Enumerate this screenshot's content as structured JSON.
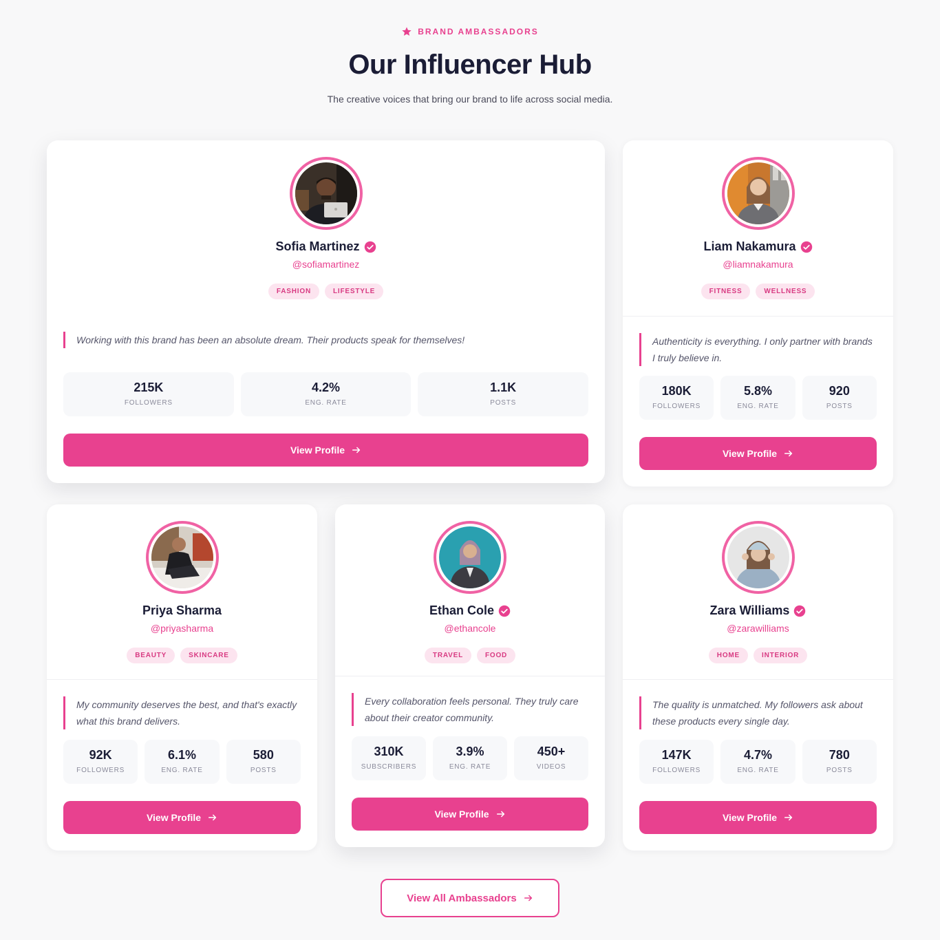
{
  "header": {
    "eyebrow": "BRAND AMBASSADORS",
    "title": "Our Influencer Hub",
    "subtitle": "The creative voices that bring our brand to life across social media."
  },
  "colors": {
    "accent": "#e8418f",
    "tag_bg": "#fce4ef",
    "heading": "#1b1d36"
  },
  "cards": [
    {
      "name": "Sofia Martinez",
      "verified": true,
      "handle": "@sofiamartinez",
      "tags": [
        "FASHION",
        "LIFESTYLE"
      ],
      "quote": "Working with this brand has been an absolute dream. Their products speak for themselves!",
      "stats": [
        {
          "value": "215K",
          "label": "FOLLOWERS"
        },
        {
          "value": "4.2%",
          "label": "ENG. RATE"
        },
        {
          "value": "1.1K",
          "label": "POSTS"
        }
      ],
      "cta": "View Profile",
      "avatar": "avatar-man-laptop"
    },
    {
      "name": "Liam Nakamura",
      "verified": true,
      "handle": "@liamnakamura",
      "tags": [
        "FITNESS",
        "WELLNESS"
      ],
      "quote": "Authenticity is everything. I only partner with brands I truly believe in.",
      "stats": [
        {
          "value": "180K",
          "label": "FOLLOWERS"
        },
        {
          "value": "5.8%",
          "label": "ENG. RATE"
        },
        {
          "value": "920",
          "label": "POSTS"
        }
      ],
      "cta": "View Profile",
      "avatar": "avatar-woman-blazer"
    },
    {
      "name": "Priya Sharma",
      "verified": false,
      "handle": "@priyasharma",
      "tags": [
        "BEAUTY",
        "SKINCARE"
      ],
      "quote": "My community deserves the best, and that's exactly what this brand delivers.",
      "stats": [
        {
          "value": "92K",
          "label": "FOLLOWERS"
        },
        {
          "value": "6.1%",
          "label": "ENG. RATE"
        },
        {
          "value": "580",
          "label": "POSTS"
        }
      ],
      "cta": "View Profile",
      "avatar": "avatar-man-seated"
    },
    {
      "name": "Ethan Cole",
      "verified": true,
      "handle": "@ethancole",
      "tags": [
        "TRAVEL",
        "FOOD"
      ],
      "quote": "Every collaboration feels personal. They truly care about their creator community.",
      "stats": [
        {
          "value": "310K",
          "label": "SUBSCRIBERS"
        },
        {
          "value": "3.9%",
          "label": "ENG. RATE"
        },
        {
          "value": "450+",
          "label": "VIDEOS"
        }
      ],
      "cta": "View Profile",
      "avatar": "avatar-woman-hijab"
    },
    {
      "name": "Zara Williams",
      "verified": true,
      "handle": "@zarawilliams",
      "tags": [
        "HOME",
        "INTERIOR"
      ],
      "quote": "The quality is unmatched. My followers ask about these products every single day.",
      "stats": [
        {
          "value": "147K",
          "label": "FOLLOWERS"
        },
        {
          "value": "4.7%",
          "label": "ENG. RATE"
        },
        {
          "value": "780",
          "label": "POSTS"
        }
      ],
      "cta": "View Profile",
      "avatar": "avatar-girl-beanie"
    }
  ],
  "footer": {
    "view_all": "View All Ambassadors"
  }
}
